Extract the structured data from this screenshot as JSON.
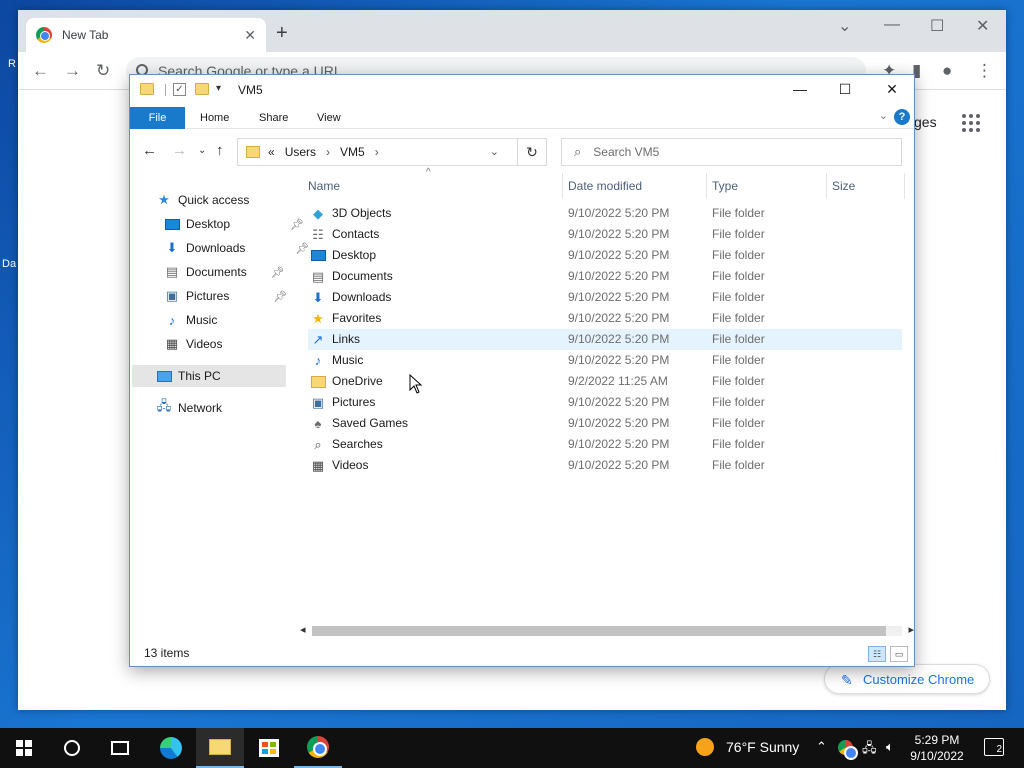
{
  "desktop": {
    "frag_r": "R",
    "frag_da": "Da"
  },
  "chrome": {
    "tab_title": "New Tab",
    "tab_close": "✕",
    "new_tab": "+",
    "omnibox_placeholder": "Search Google or type a URL",
    "images_link": "ges",
    "customize_label": "Customize Chrome",
    "pencil": "✎"
  },
  "explorer": {
    "title": "VM5",
    "ribbon": {
      "file": "File",
      "home": "Home",
      "share": "Share",
      "view": "View",
      "help": "?"
    },
    "address": {
      "prefix": "«",
      "crumbs": [
        "Users",
        "VM5"
      ]
    },
    "search_placeholder": "Search VM5",
    "nav": {
      "quick_access": "Quick access",
      "pinned": [
        {
          "label": "Desktop",
          "pinned": true
        },
        {
          "label": "Downloads",
          "pinned": true
        },
        {
          "label": "Documents",
          "pinned": true
        },
        {
          "label": "Pictures",
          "pinned": true
        },
        {
          "label": "Music",
          "pinned": false
        },
        {
          "label": "Videos",
          "pinned": false
        }
      ],
      "this_pc": "This PC",
      "network": "Network"
    },
    "columns": {
      "name": "Name",
      "date": "Date modified",
      "type": "Type",
      "size": "Size"
    },
    "rows": [
      {
        "name": "3D Objects",
        "date": "9/10/2022 5:20 PM",
        "type": "File folder",
        "icon": "3d-objects-icon"
      },
      {
        "name": "Contacts",
        "date": "9/10/2022 5:20 PM",
        "type": "File folder",
        "icon": "contacts-icon"
      },
      {
        "name": "Desktop",
        "date": "9/10/2022 5:20 PM",
        "type": "File folder",
        "icon": "desktop-icon"
      },
      {
        "name": "Documents",
        "date": "9/10/2022 5:20 PM",
        "type": "File folder",
        "icon": "documents-icon"
      },
      {
        "name": "Downloads",
        "date": "9/10/2022 5:20 PM",
        "type": "File folder",
        "icon": "downloads-icon"
      },
      {
        "name": "Favorites",
        "date": "9/10/2022 5:20 PM",
        "type": "File folder",
        "icon": "favorites-icon"
      },
      {
        "name": "Links",
        "date": "9/10/2022 5:20 PM",
        "type": "File folder",
        "icon": "links-icon"
      },
      {
        "name": "Music",
        "date": "9/10/2022 5:20 PM",
        "type": "File folder",
        "icon": "music-icon"
      },
      {
        "name": "OneDrive",
        "date": "9/2/2022 11:25 AM",
        "type": "File folder",
        "icon": "folder-icon"
      },
      {
        "name": "Pictures",
        "date": "9/10/2022 5:20 PM",
        "type": "File folder",
        "icon": "pictures-icon"
      },
      {
        "name": "Saved Games",
        "date": "9/10/2022 5:20 PM",
        "type": "File folder",
        "icon": "saved-games-icon"
      },
      {
        "name": "Searches",
        "date": "9/10/2022 5:20 PM",
        "type": "File folder",
        "icon": "searches-icon"
      },
      {
        "name": "Videos",
        "date": "9/10/2022 5:20 PM",
        "type": "File folder",
        "icon": "videos-icon"
      }
    ],
    "status": "13 items"
  },
  "taskbar": {
    "weather": "76°F  Sunny",
    "time": "5:29 PM",
    "date": "9/10/2022",
    "notifications": "2"
  },
  "colors": {
    "accent": "#1979ca",
    "folder": "#f8d775",
    "taskbar": "#101010",
    "hover_row": "#e5f3ff"
  }
}
